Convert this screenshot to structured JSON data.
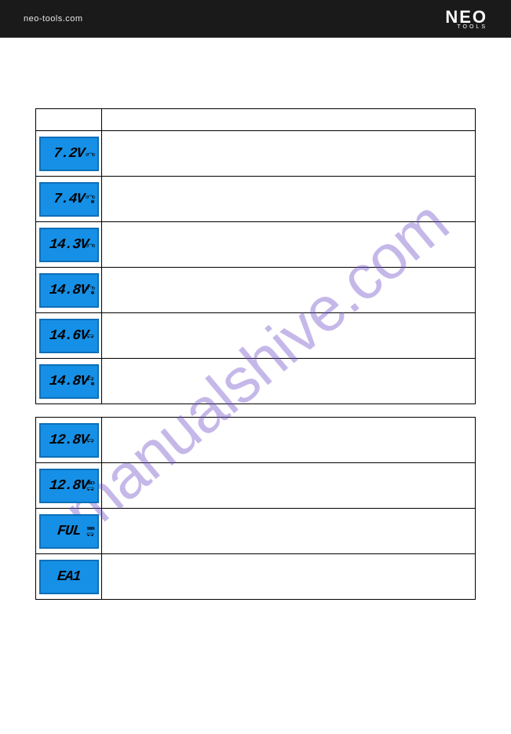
{
  "header": {
    "url": "neo-tools.com",
    "logo_main": "NEO",
    "logo_sub": "TOOLS"
  },
  "watermark": "manualshive.com",
  "table1": {
    "header_left": "",
    "header_right": "",
    "rows": [
      {
        "lcd": "7.2V",
        "icon": "moto",
        "desc": ""
      },
      {
        "lcd": "7.4V",
        "icon": "moto-snow",
        "desc": ""
      },
      {
        "lcd": "14.3V",
        "icon": "moto",
        "desc": ""
      },
      {
        "lcd": "14.8V",
        "icon": "moto-snow",
        "desc": ""
      },
      {
        "lcd": "14.6V",
        "icon": "car",
        "desc": ""
      },
      {
        "lcd": "14.8V",
        "icon": "car-snow",
        "desc": ""
      }
    ]
  },
  "table2": {
    "rows": [
      {
        "lcd": "12.8V",
        "icon": "car",
        "desc": ""
      },
      {
        "lcd": "12.8V",
        "icon": "car-batt",
        "desc": ""
      },
      {
        "lcd": "FUL",
        "icon": "car-batt",
        "desc": ""
      },
      {
        "lcd": "EA1",
        "icon": "",
        "desc": ""
      }
    ]
  }
}
